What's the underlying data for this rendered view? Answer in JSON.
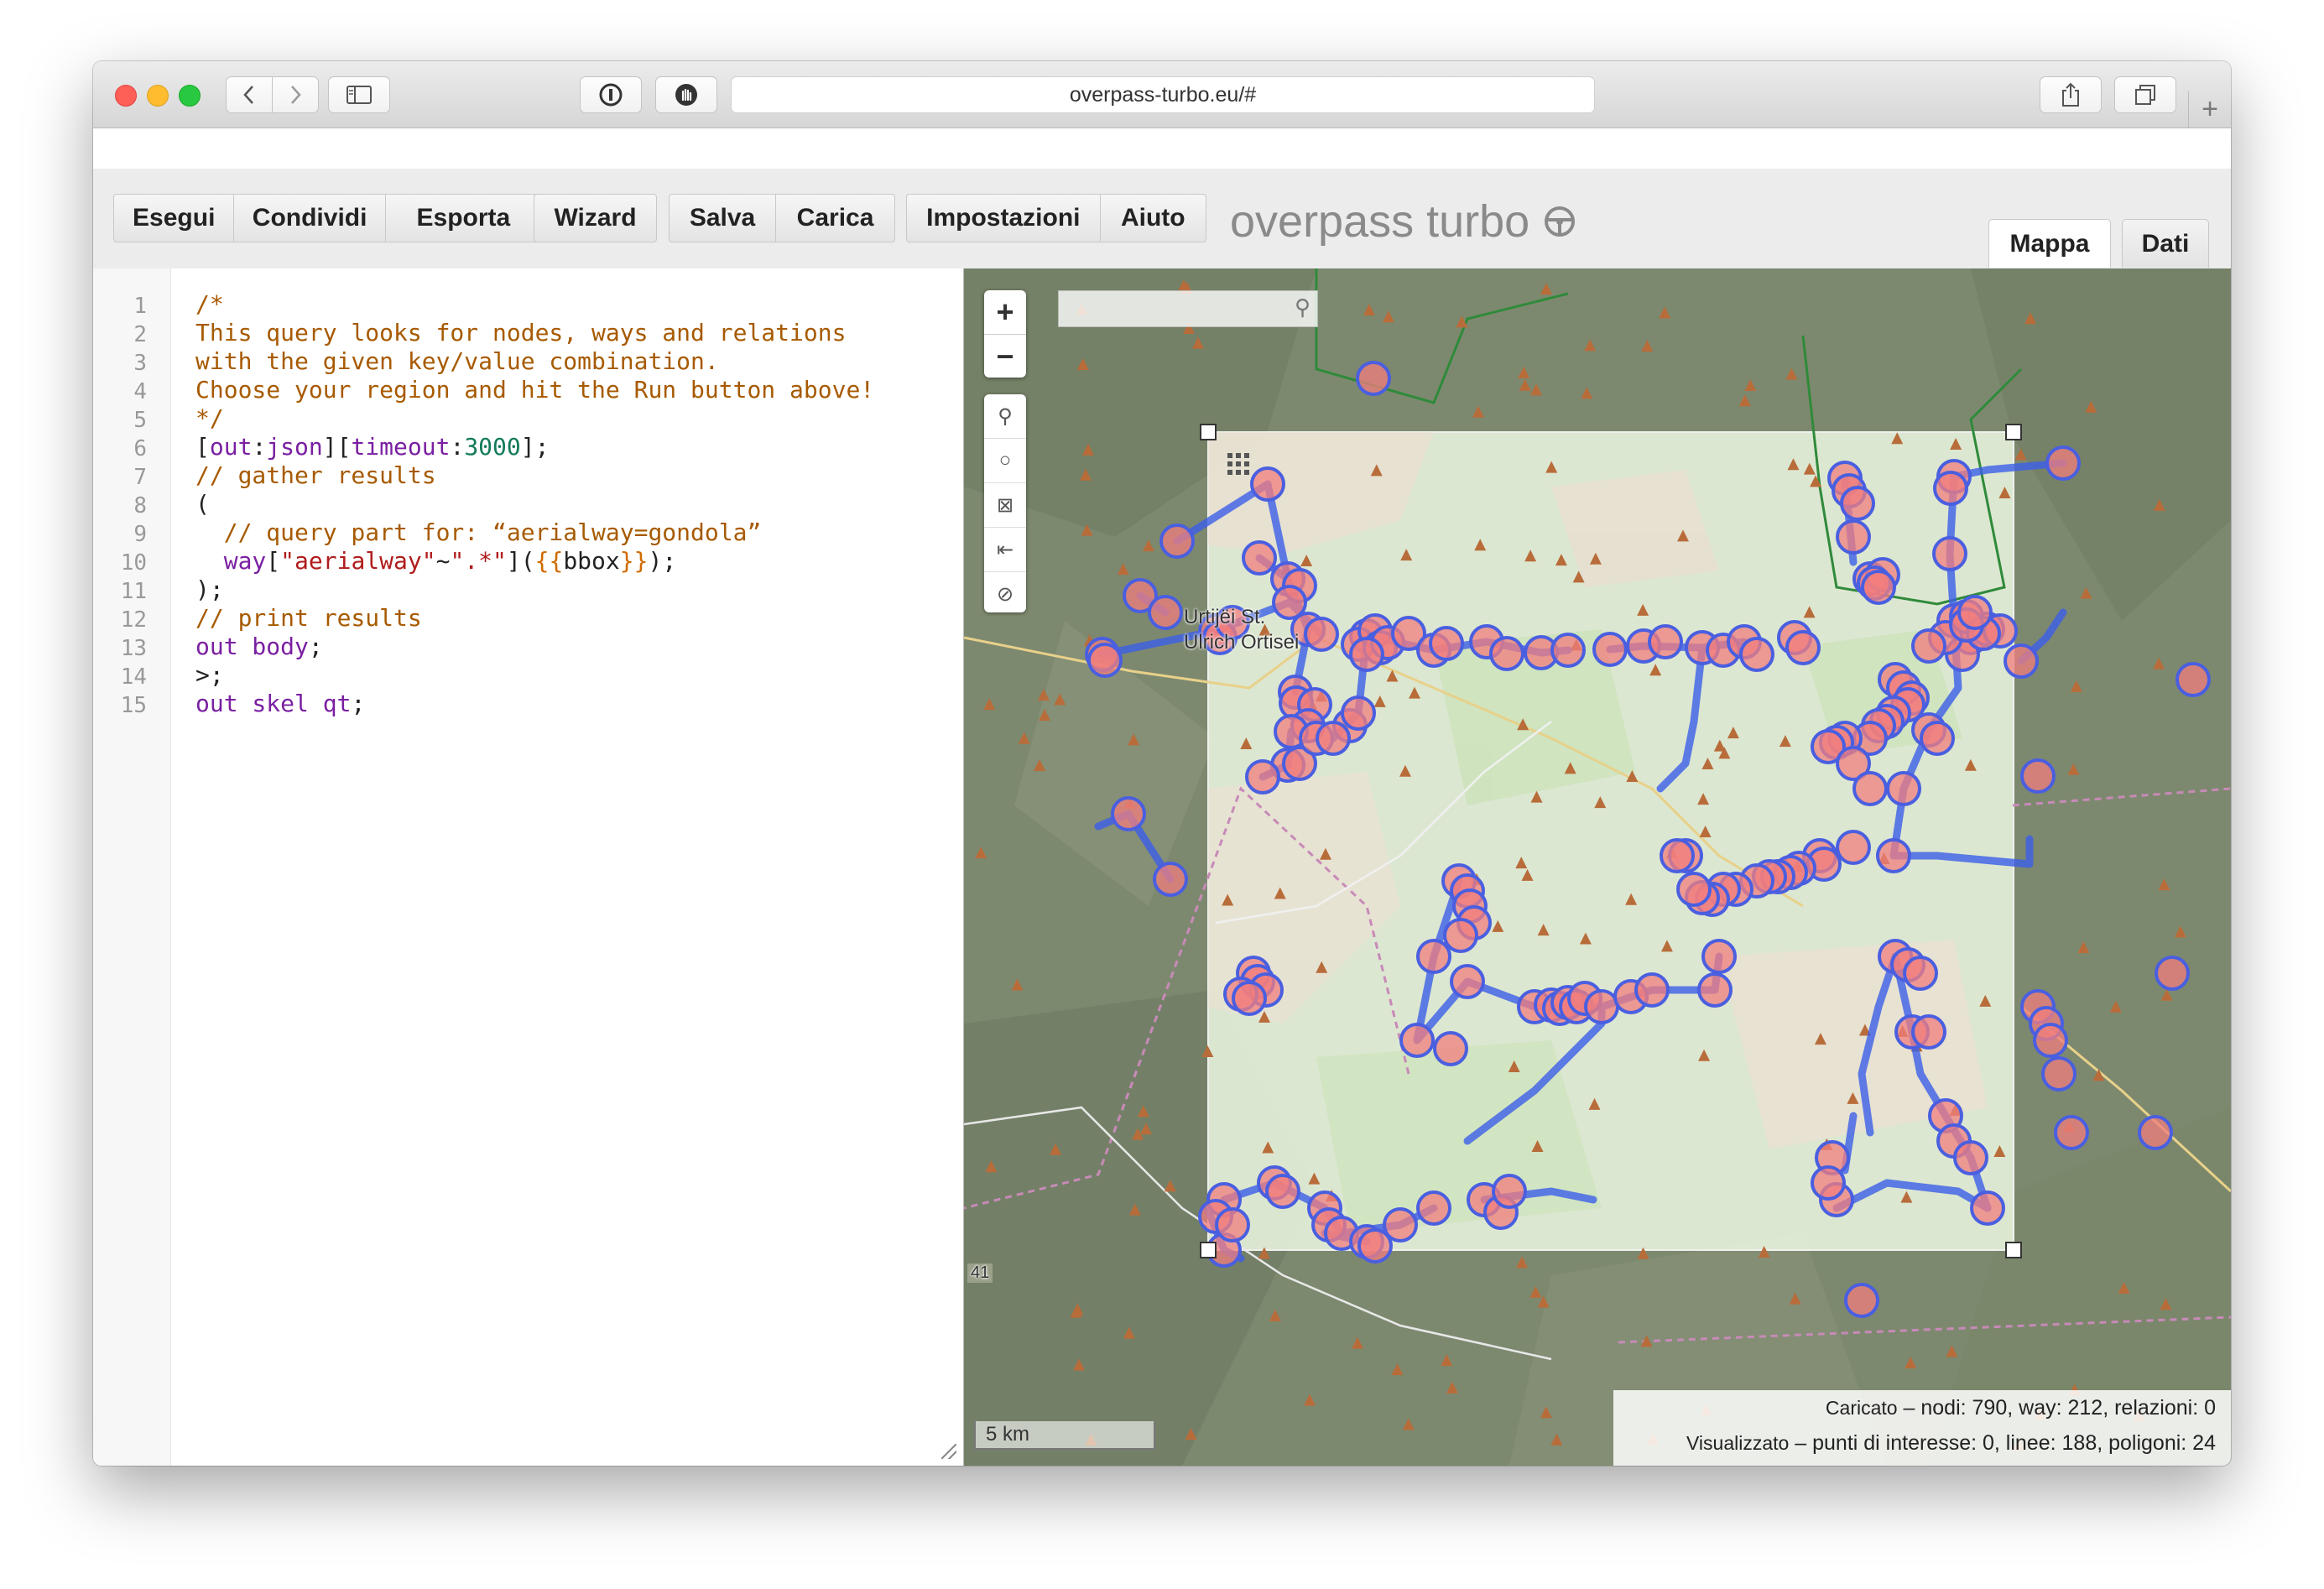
{
  "browser": {
    "url": "overpass-turbo.eu/#"
  },
  "toolbar": {
    "run": "Esegui",
    "share": "Condividi",
    "export": "Esporta",
    "wizard": "Wizard",
    "save": "Salva",
    "load": "Carica",
    "settings": "Impostazioni",
    "help": "Aiuto",
    "brand": "overpass turbo"
  },
  "tabs": {
    "map": "Mappa",
    "data": "Dati"
  },
  "editor": {
    "line_numbers": [
      "1",
      "2",
      "3",
      "4",
      "5",
      "6",
      "7",
      "8",
      "9",
      "10",
      "11",
      "12",
      "13",
      "14",
      "15"
    ],
    "lines": [
      [
        {
          "t": "/*",
          "c": "c-comment"
        }
      ],
      [
        {
          "t": "This query looks for nodes, ways and relations",
          "c": "c-comment"
        }
      ],
      [
        {
          "t": "with the given key/value combination.",
          "c": "c-comment"
        }
      ],
      [
        {
          "t": "Choose your region and hit the Run button above!",
          "c": "c-comment"
        }
      ],
      [
        {
          "t": "*/",
          "c": "c-comment"
        }
      ],
      [
        {
          "t": "[",
          "c": "c-bracket"
        },
        {
          "t": "out",
          "c": "c-key"
        },
        {
          "t": ":",
          "c": "c-bracket"
        },
        {
          "t": "json",
          "c": "c-key"
        },
        {
          "t": "][",
          "c": "c-bracket"
        },
        {
          "t": "timeout",
          "c": "c-key"
        },
        {
          "t": ":",
          "c": "c-bracket"
        },
        {
          "t": "3000",
          "c": "c-num"
        },
        {
          "t": "];",
          "c": "c-bracket"
        }
      ],
      [
        {
          "t": "// gather results",
          "c": "c-comment"
        }
      ],
      [
        {
          "t": "(",
          "c": "c-bracket"
        }
      ],
      [
        {
          "t": "  // query part for: “aerialway=gondola”",
          "c": "c-comment"
        }
      ],
      [
        {
          "t": "  way",
          "c": "c-key"
        },
        {
          "t": "[",
          "c": "c-bracket"
        },
        {
          "t": "\"aerialway\"",
          "c": "c-str"
        },
        {
          "t": "~",
          "c": "c-bracket"
        },
        {
          "t": "\".*\"",
          "c": "c-str"
        },
        {
          "t": "](",
          "c": "c-bracket"
        },
        {
          "t": "{{",
          "c": "c-tpl"
        },
        {
          "t": "bbox",
          "c": "c-bracket"
        },
        {
          "t": "}}",
          "c": "c-tpl"
        },
        {
          "t": ");",
          "c": "c-bracket"
        }
      ],
      [
        {
          "t": ");",
          "c": "c-bracket"
        }
      ],
      [
        {
          "t": "// print results",
          "c": "c-comment"
        }
      ],
      [
        {
          "t": "out body",
          "c": "c-key"
        },
        {
          "t": ";",
          "c": "c-bracket"
        }
      ],
      [
        {
          "t": ">;",
          "c": "c-bracket"
        }
      ],
      [
        {
          "t": "out skel qt",
          "c": "c-key"
        },
        {
          "t": ";",
          "c": "c-bracket"
        }
      ]
    ]
  },
  "map": {
    "place_label_1": "Urtijëi St.",
    "place_label_2": "Ulrich Ortisei",
    "road_number": "41",
    "scale": "5 km",
    "stats_loaded_label": "Caricato",
    "stats_loaded_value": " – nodi: 790, way: 212, relazioni: 0",
    "stats_shown_label": "Visualizzato",
    "stats_shown_value": " – punti di interesse: 0, linee: 188, poligoni: 24",
    "colors": {
      "line": "#3c5fe8",
      "node_fill": "#f27d7d",
      "node_stroke": "#4a5fe0",
      "bbox_fill": "#eaf5df"
    }
  }
}
